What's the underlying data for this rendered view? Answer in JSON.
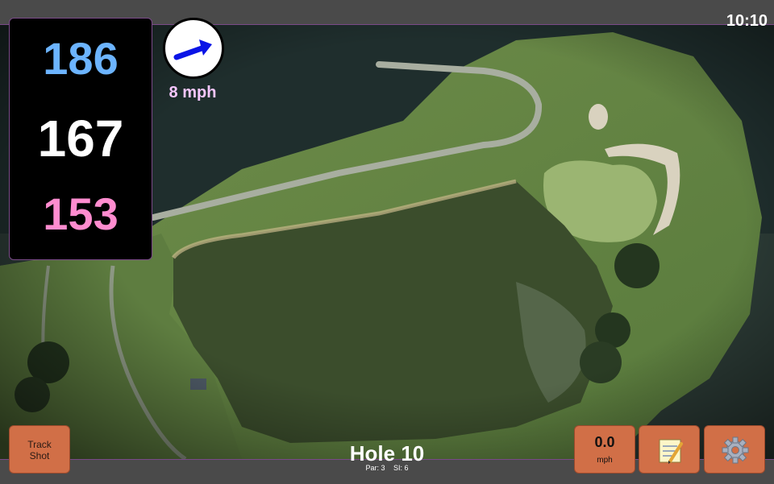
{
  "status": {
    "time": "10:10"
  },
  "distances": {
    "back": "186",
    "middle": "167",
    "front": "153"
  },
  "wind": {
    "speed_label": "8 mph",
    "arrow_color": "#0a14e6"
  },
  "buttons": {
    "track_shot_label": "Track\nShot",
    "speed_value": "0.0",
    "speed_unit": "mph",
    "notes_icon": "notepad-icon",
    "settings_icon": "gear-icon"
  },
  "hole": {
    "title": "Hole 10",
    "par_label": "Par: 3",
    "si_label": "SI: 6"
  },
  "colors": {
    "back_distance": "#6cb4ff",
    "middle_distance": "#ffffff",
    "front_distance": "#ff8ccf",
    "button_orange": "#d16f47",
    "bar_accent": "#7a4a88"
  }
}
